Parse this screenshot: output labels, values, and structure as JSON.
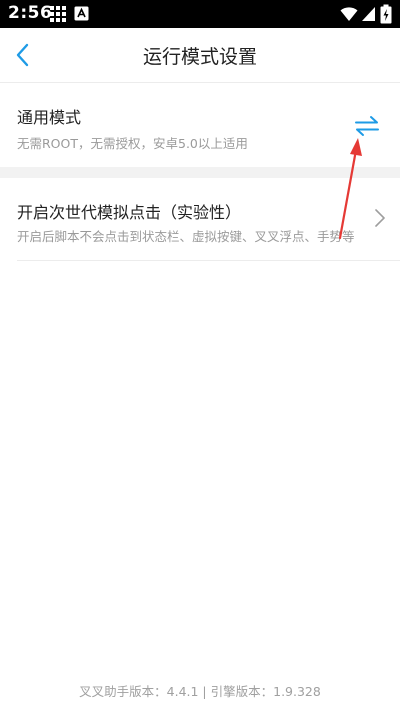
{
  "status_bar": {
    "time": "2:56",
    "icons": [
      "grid-icon",
      "app-icon",
      "wifi-icon",
      "signal-icon",
      "battery-charging-icon"
    ],
    "background": "#000000"
  },
  "header": {
    "title": "运行模式设置",
    "back_icon": "chevron-left-icon",
    "accent": "#1e9be6"
  },
  "settings": [
    {
      "title": "通用模式",
      "description": "无需ROOT，无需授权，安卓5.0以上适用",
      "trailing_icon": "switch-arrows-icon"
    },
    {
      "title": "开启次世代模拟点击（实验性）",
      "description": "开启后脚本不会点击到状态栏、虚拟按键、叉叉浮点、手势等",
      "trailing_icon": "chevron-right-icon"
    }
  ],
  "annotation": {
    "type": "red-arrow",
    "color": "#e53935",
    "points_to": "switch-arrows-icon"
  },
  "footer": {
    "version_text": "叉叉助手版本：4.4.1 | 引擎版本：1.9.328"
  }
}
